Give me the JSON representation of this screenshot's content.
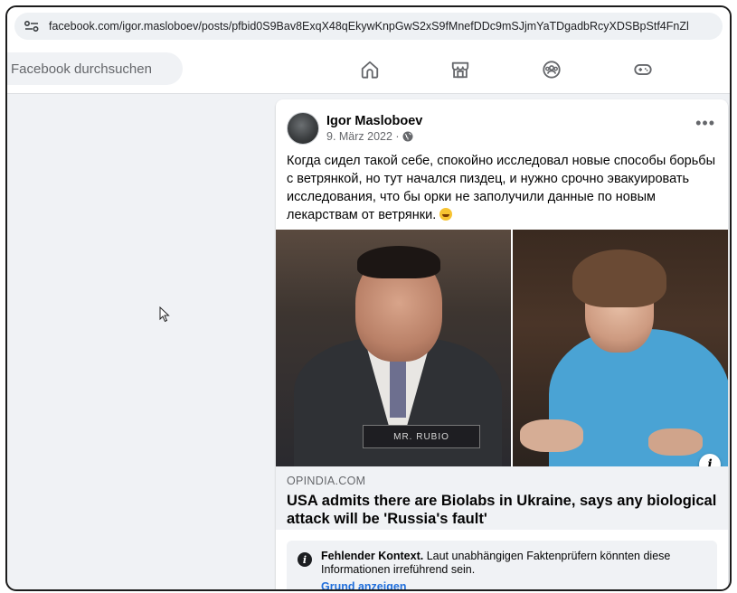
{
  "browser": {
    "url": "facebook.com/igor.masloboev/posts/pfbid0S9Bav8ExqX48qEkywKnpGwS2xS9fMnefDDc9mSJjmYaTDgadbRcyXDSBpStf4FnZl",
    "site_info_icon": "tune-icon"
  },
  "fbnav": {
    "search_placeholder": "Facebook durchsuchen",
    "icons": [
      "home-icon",
      "marketplace-icon",
      "groups-icon",
      "gaming-icon"
    ]
  },
  "post": {
    "author": "Igor Masloboev",
    "date": "9. März 2022 ·",
    "privacy_icon": "globe-icon",
    "more_label": "•••",
    "text": "Когда сидел такой себе, спокойно исследовал новые способы борьбы с ветрянкой, но тут начался пиздец, и нужно срочно эвакуировать исследования, что бы орки не заполучили данные по новым лекарствам от ветрянки.",
    "emoji_icon": "grinning-face-icon",
    "image_nameplate": "MR. RUBIO",
    "info_label": "i",
    "link": {
      "domain": "OPINDIA.COM",
      "headline": "USA admits there are Biolabs in Ukraine, says any biological attack will be 'Russia's fault'"
    },
    "context": {
      "title": "Fehlender Kontext.",
      "body": " Laut unabhängigen Faktenprüfern könnten diese Informationen irreführend sein.",
      "link": "Grund anzeigen"
    }
  },
  "colors": {
    "page_bg": "#f0f2f5",
    "link_blue": "#216fdb",
    "secondary_text": "#65676b"
  }
}
